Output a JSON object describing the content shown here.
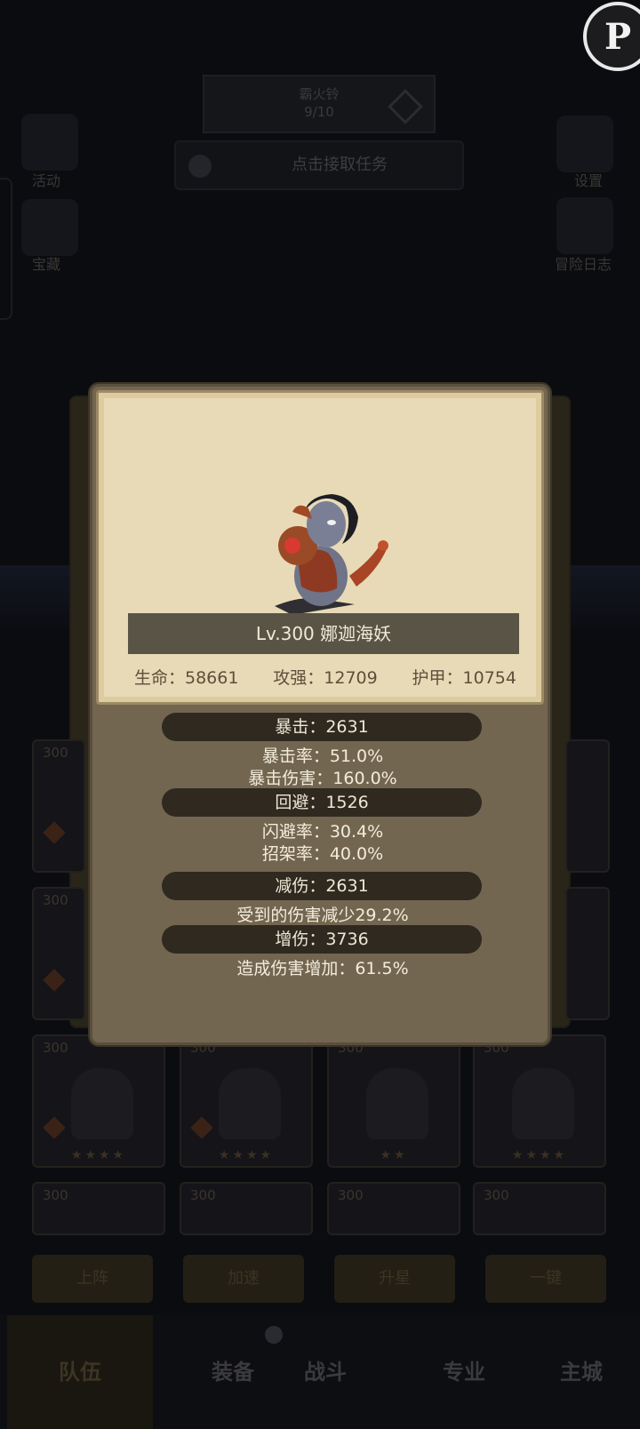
{
  "background": {
    "beacon": {
      "title": "霸火铃",
      "progress": "9/10"
    },
    "quest_text": "点击接取任务",
    "left_icons": [
      {
        "label": "活动"
      },
      {
        "label": "宝藏"
      }
    ],
    "right_icons": [
      {
        "label": "设置"
      },
      {
        "label": "冒险日志"
      }
    ],
    "hero_cards": [
      {
        "level": "300",
        "stars": "★★★★"
      },
      {
        "level": "300",
        "stars": "★★★★"
      },
      {
        "level": "300",
        "stars": "★★"
      },
      {
        "level": "300",
        "stars": "★★★★"
      }
    ],
    "hero_cards_row2": [
      "300",
      "300",
      "300",
      "300"
    ],
    "side_cards_top": [
      "300",
      "300"
    ],
    "tab_buttons": [
      "上阵",
      "加速",
      "升星",
      "一键"
    ],
    "bottom_nav": [
      {
        "label": "队伍",
        "active": true
      },
      {
        "label": "装备",
        "active": false
      },
      {
        "label": "战斗",
        "active": false
      },
      {
        "label": "专业",
        "active": false
      },
      {
        "label": "主城",
        "active": false
      }
    ]
  },
  "hero": {
    "name_line": "Lv.300 娜迦海妖",
    "hp": "生命：58661",
    "attack": "攻强：12709",
    "armor": "护甲：10754"
  },
  "stats": {
    "crit": "暴击：2631",
    "crit_rate": "暴击率：51.0%",
    "crit_damage": "暴击伤害：160.0%",
    "dodge": "回避：1526",
    "evade_rate": "闪避率：30.4%",
    "parry_rate": "招架率：40.0%",
    "damage_reduction": "减伤：2631",
    "damage_reduction_desc": "受到的伤害减少29.2%",
    "damage_increase": "增伤：3736",
    "damage_increase_desc": "造成伤害增加：61.5%"
  },
  "colors": {
    "parchment": "#e8dab7",
    "panel": "#736650",
    "pill": "#2f2920",
    "name_bar": "#5a5446"
  }
}
